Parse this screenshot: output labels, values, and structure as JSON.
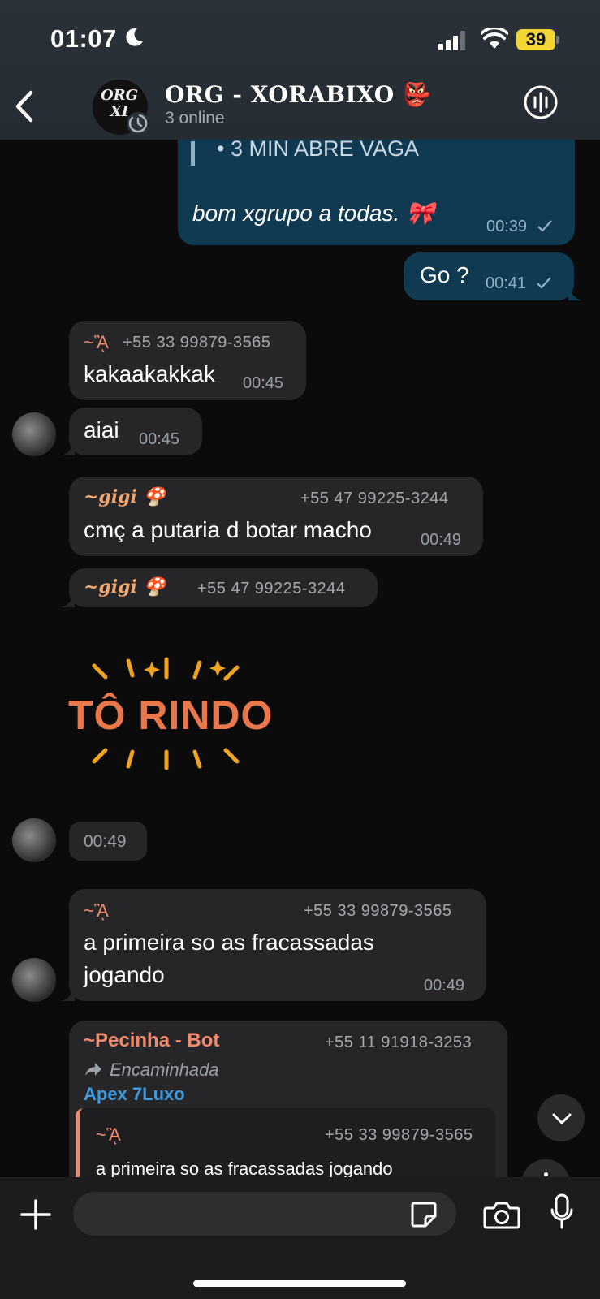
{
  "status_bar": {
    "time": "01:07",
    "battery": "39"
  },
  "header": {
    "title": "ORG - XORABIXO 👺",
    "subtitle": "3 online",
    "avatar_text": "ORG XI"
  },
  "messages": {
    "m1": {
      "quote": "• 3 MIN ABRE VAGA",
      "text": "bom xgrupo a todas. 🎀",
      "time": "00:39"
    },
    "m2": {
      "text": "Go ?",
      "time": "00:41"
    },
    "m3": {
      "sender": "~𝃻",
      "sender_name": "~ᾋ",
      "phone": "+55 33 99879-3565",
      "text": "kakaakakkak",
      "time": "00:45"
    },
    "m4": {
      "text": "aiai",
      "time": "00:45"
    },
    "m5": {
      "sender": "~𝒈𝒊𝒈𝒊 🍄",
      "phone": "+55 47 99225-3244",
      "text": "cmç a putaria d botar macho",
      "time": "00:49"
    },
    "m6": {
      "sender": "~𝒈𝒊𝒈𝒊 🍄",
      "phone": "+55 47 99225-3244"
    },
    "sticker": {
      "text": "TÔ RINDO"
    },
    "m7": {
      "time": "00:49"
    },
    "m8": {
      "sender": "~ᾋ",
      "phone": "+55 33 99879-3565",
      "text_line1": "a primeira so as fracassadas",
      "text_line2": "jogando",
      "time": "00:49"
    },
    "m9": {
      "sender": "~Pecinha - Bot",
      "phone": "+55 11 91918-3253",
      "forwarded": "Encaminhada",
      "origin": "Apex 7Luxo",
      "quoted_sender": "~ᾋ",
      "quoted_phone": "+55 33 99879-3565",
      "quoted_text": "a primeira so as fracassadas jogando"
    }
  },
  "colors": {
    "header_bg": "#252c33",
    "incoming": "#262628",
    "outgoing": "#0f3a52",
    "gigi": "#f0a873",
    "salmon": "#f08a6b",
    "link": "#3b9ae1",
    "sticker": "#e8774a"
  },
  "icons": [
    "back-icon",
    "voice-chat-icon",
    "plus-icon",
    "sticker-icon",
    "camera-icon",
    "microphone-icon",
    "chevron-down-icon",
    "check-icon"
  ]
}
